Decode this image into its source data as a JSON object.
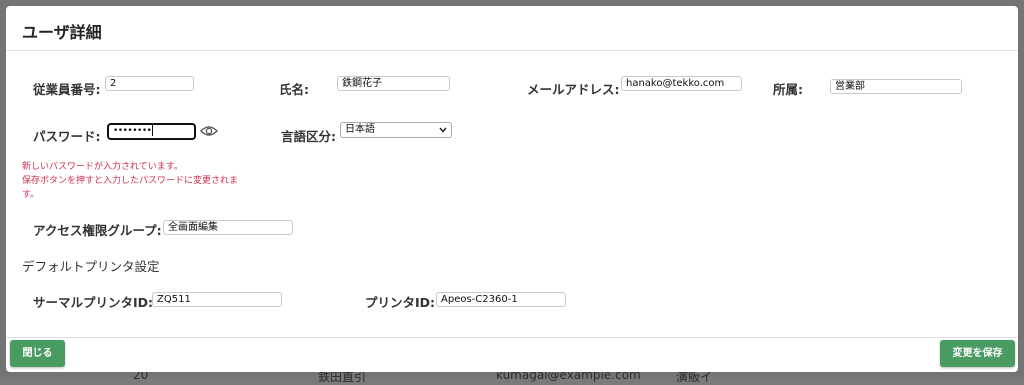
{
  "background": {
    "peek_1": "20",
    "peek_2": "鉄田直引",
    "peek_3": "kumagai@example.com",
    "peek_4": "演販イ"
  },
  "modal": {
    "title": "ユーザ詳細"
  },
  "fields": {
    "employee_no": {
      "label": "従業員番号:",
      "value": "2"
    },
    "name": {
      "label": "氏名:",
      "value": "鉄鋼花子"
    },
    "email": {
      "label": "メールアドレス:",
      "value": "hanako@tekko.com"
    },
    "department": {
      "label": "所属:",
      "value": "営業部"
    },
    "password": {
      "label": "パスワード:",
      "value": "••••••••"
    },
    "language": {
      "label": "言語区分:",
      "value": "日本語"
    },
    "access_group": {
      "label": "アクセス権限グループ:",
      "value": "全画面編集"
    }
  },
  "warning": {
    "line1": "新しいパスワードが入力されています。",
    "line2": "保存ボタンを押すと入力したパスワードに変更されま",
    "line3": "す。"
  },
  "printer_section": {
    "title": "デフォルトプリンタ設定",
    "thermal": {
      "label": "サーマルプリンタID:",
      "value": "ZQ511"
    },
    "printer": {
      "label": "プリンタID:",
      "value": "Apeos-C2360-1"
    }
  },
  "footer": {
    "close_label": "閉じる",
    "save_label": "変更を保存"
  },
  "colors": {
    "button": "#4a9b62",
    "warning": "#d0304d"
  }
}
